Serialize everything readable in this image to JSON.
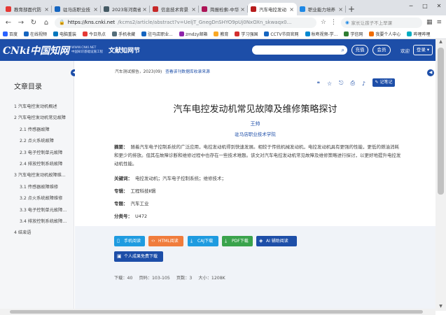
{
  "browser": {
    "tabs": [
      {
        "label": "教育部面代防",
        "color": "#e53935"
      },
      {
        "label": "驻马店职业技",
        "color": "#1565c0"
      },
      {
        "label": "2023年河南省",
        "color": "#455a64"
      },
      {
        "label": "信息技术背景",
        "color": "#c62828"
      },
      {
        "label": "简报检索-中华",
        "color": "#ad1457"
      },
      {
        "label": "汽车电控发动",
        "color": "#b71c1c",
        "active": true
      },
      {
        "label": "职业能力培养",
        "color": "#1e88e5"
      }
    ],
    "url_host": "https://kns.cnki.net",
    "url_path": "/kcms2/article/abstract?v=UeljT_GnegDnSHYO9pUj0NxOXn_skwaqx0...",
    "search_placeholder": "家长让孩子不上早课",
    "bookmarks": [
      {
        "label": "百度",
        "color": "#2962ff"
      },
      {
        "label": "在线视频",
        "color": "#1565c0"
      },
      {
        "label": "电脑重装",
        "color": "#0277bd"
      },
      {
        "label": "今日热点",
        "color": "#e53935"
      },
      {
        "label": "手机收藏",
        "color": "#546e7a"
      },
      {
        "label": "驻马店职业...",
        "color": "#1565c0"
      },
      {
        "label": "zmdzy邮箱",
        "color": "#8e24aa"
      },
      {
        "label": "教育",
        "color": "#f9a825"
      },
      {
        "label": "学习强国",
        "color": "#d32f2f"
      },
      {
        "label": "CCTV节目官网",
        "color": "#1565c0"
      },
      {
        "label": "秋咚视频-学...",
        "color": "#0288d1"
      },
      {
        "label": "学信网",
        "color": "#2e7d32"
      },
      {
        "label": "我要个人中心",
        "color": "#ef6c00"
      },
      {
        "label": "哔哩哔哩",
        "color": "#00acc1"
      }
    ]
  },
  "header": {
    "logo_text": "CNki中国知网",
    "logo_sub": "WWW.CNKI.NET\n中国知识基础设施工程",
    "brand": "文献知网节",
    "btn_home": "充值",
    "btn_member": "会员",
    "welcome": "欢迎",
    "login": "登录"
  },
  "sidebar": {
    "title": "文章目录",
    "items": [
      {
        "label": "1 汽车电控发动机概述",
        "sub": false
      },
      {
        "label": "2 汽车电控发动机常见故障",
        "sub": false
      },
      {
        "label": "2.1 传感器故障",
        "sub": true
      },
      {
        "label": "2.2 点火系统故障",
        "sub": true
      },
      {
        "label": "2.3 电子控制单元故障",
        "sub": true
      },
      {
        "label": "2.4 排放控制系统故障",
        "sub": true
      },
      {
        "label": "3 汽车电控发动机故障维...",
        "sub": false
      },
      {
        "label": "3.1 传感器故障维修",
        "sub": true
      },
      {
        "label": "3.2 点火系统故障维修",
        "sub": true
      },
      {
        "label": "3.3 电子控制单元故障...",
        "sub": true
      },
      {
        "label": "3.4 排放控制系统故障...",
        "sub": true
      },
      {
        "label": "4 结束语",
        "sub": false
      }
    ]
  },
  "article": {
    "source": "汽车测试报告，2023(09)",
    "source_link": "查看该刊数据库收录来源",
    "note_btn": "记笔记",
    "title": "汽车电控发动机常见故障及维修策略探讨",
    "author": "王帅",
    "org": "驻马店职业技术学院",
    "abstract_label": "摘要：",
    "abstract": "随着汽车电子控制系统的广泛应用，电控发动机得到快速发展。相较于传统机械发动机，电控发动机具有更强的性能，更低的燃油消耗和更少的排放。但其在故障诊断和维修过程中也存在一些技术难题。该文对汽车电控发动机常见故障及维修策略进行探讨，以更好地提升电控发动机性能。",
    "keywords_label": "关键词：",
    "keywords": "电控发动机；汽车电子控制系统；维修技术；",
    "series_label": "专辑：",
    "series": "工程科技Ⅱ辑",
    "topic_label": "专题：",
    "topic": "汽车工业",
    "class_label": "分类号：",
    "class": "U472"
  },
  "downloads": {
    "mobile": "手机阅读",
    "html": "HTML阅读",
    "caj": "CAJ下载",
    "pdf": "PDF下载",
    "ai": "AI 辅助阅读",
    "personal": "个人成果免费下载",
    "colors": {
      "mobile": "#1e9be0",
      "html": "#f07c3c",
      "caj": "#1e9be0",
      "pdf": "#3aa34c",
      "ai": "#1d4ea8",
      "personal": "#1d4ea8"
    }
  },
  "meta": {
    "downloads": "下载：40",
    "pages": "页码：103-105",
    "page_count": "页数：3",
    "size": "大小：1208K"
  }
}
